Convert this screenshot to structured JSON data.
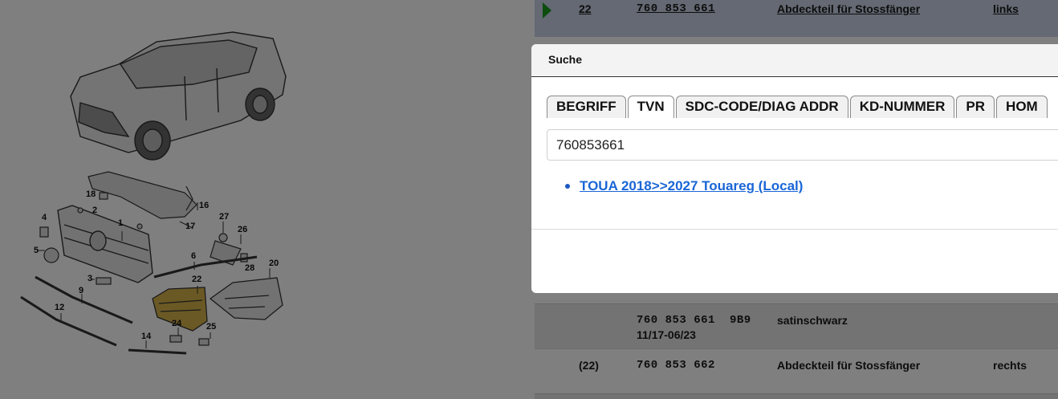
{
  "diagram": {
    "callouts": [
      "18",
      "2",
      "16",
      "4",
      "1",
      "17",
      "27",
      "26",
      "5",
      "6",
      "28",
      "20",
      "3",
      "22",
      "9",
      "12",
      "24",
      "25",
      "14"
    ]
  },
  "parts_table": {
    "selected_row": {
      "pos": "22",
      "part_number": "760 853 661",
      "description": "Abdeckteil für Stossfänger",
      "side": "links"
    },
    "detail_row": {
      "part_number": "760 853 661",
      "code": "9B9",
      "color": "satinschwarz",
      "date_range": "11/17-06/23"
    },
    "next_row": {
      "pos": "(22)",
      "part_number": "760 853 662",
      "description": "Abdeckteil für Stossfänger",
      "side": "rechts"
    }
  },
  "dialog": {
    "title": "Suche",
    "tabs": [
      {
        "label": "BEGRIFF",
        "active": false
      },
      {
        "label": "TVN",
        "active": true
      },
      {
        "label": "SDC-CODE/DIAG ADDR",
        "active": false
      },
      {
        "label": "KD-NUMMER",
        "active": false
      },
      {
        "label": "PR",
        "active": false
      },
      {
        "label": "HOM",
        "active": false
      }
    ],
    "search_value": "760853661",
    "results": [
      {
        "label": "TOUA 2018>>2027 Touareg (Local)"
      }
    ]
  },
  "colors": {
    "overlay": "#000000",
    "link": "#1a66d6",
    "selected_row": "#c9d3e6",
    "arrow": "#1a9a1a"
  }
}
